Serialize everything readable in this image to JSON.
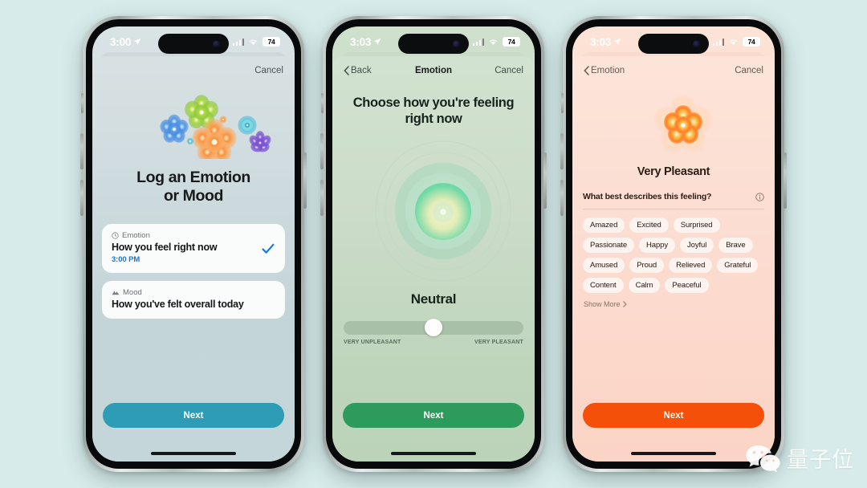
{
  "background_color": "#d7ecea",
  "phones": [
    {
      "id": "phone-log-emotion",
      "status_bar": {
        "time": "3:00",
        "battery": "74"
      },
      "nav": {
        "cancel": "Cancel"
      },
      "title_line1": "Log an Emotion",
      "title_line2": "or Mood",
      "cards": [
        {
          "label": "Emotion",
          "icon": "clock-icon",
          "title": "How you feel right now",
          "time": "3:00 PM",
          "selected": true
        },
        {
          "label": "Mood",
          "icon": "mountains-icon",
          "title": "How you've felt overall today",
          "time": "",
          "selected": false
        }
      ],
      "cta": {
        "label": "Next",
        "color": "#2e9cb4"
      }
    },
    {
      "id": "phone-choose-feeling",
      "status_bar": {
        "time": "3:03",
        "battery": "74"
      },
      "nav": {
        "back": "Back",
        "title": "Emotion",
        "cancel": "Cancel"
      },
      "prompt_line1": "Choose how you're feeling",
      "prompt_line2": "right now",
      "mood_word": "Neutral",
      "slider": {
        "value_percent": 50,
        "min_label": "VERY UNPLEASANT",
        "max_label": "VERY PLEASANT"
      },
      "cta": {
        "label": "Next",
        "color": "#2d9b5b"
      }
    },
    {
      "id": "phone-very-pleasant",
      "status_bar": {
        "time": "3:03",
        "battery": "74"
      },
      "nav": {
        "back": "Emotion",
        "cancel": "Cancel"
      },
      "pleasant_label": "Very Pleasant",
      "describe_question": "What best describes this feeling?",
      "chips": [
        "Amazed",
        "Excited",
        "Surprised",
        "Passionate",
        "Happy",
        "Joyful",
        "Brave",
        "Amused",
        "Proud",
        "Relieved",
        "Grateful",
        "Content",
        "Calm",
        "Peaceful"
      ],
      "show_more": "Show More",
      "cta": {
        "label": "Next",
        "color": "#f4500a"
      }
    }
  ],
  "watermark": {
    "text": "量子位",
    "icon": "wechat-icon"
  }
}
